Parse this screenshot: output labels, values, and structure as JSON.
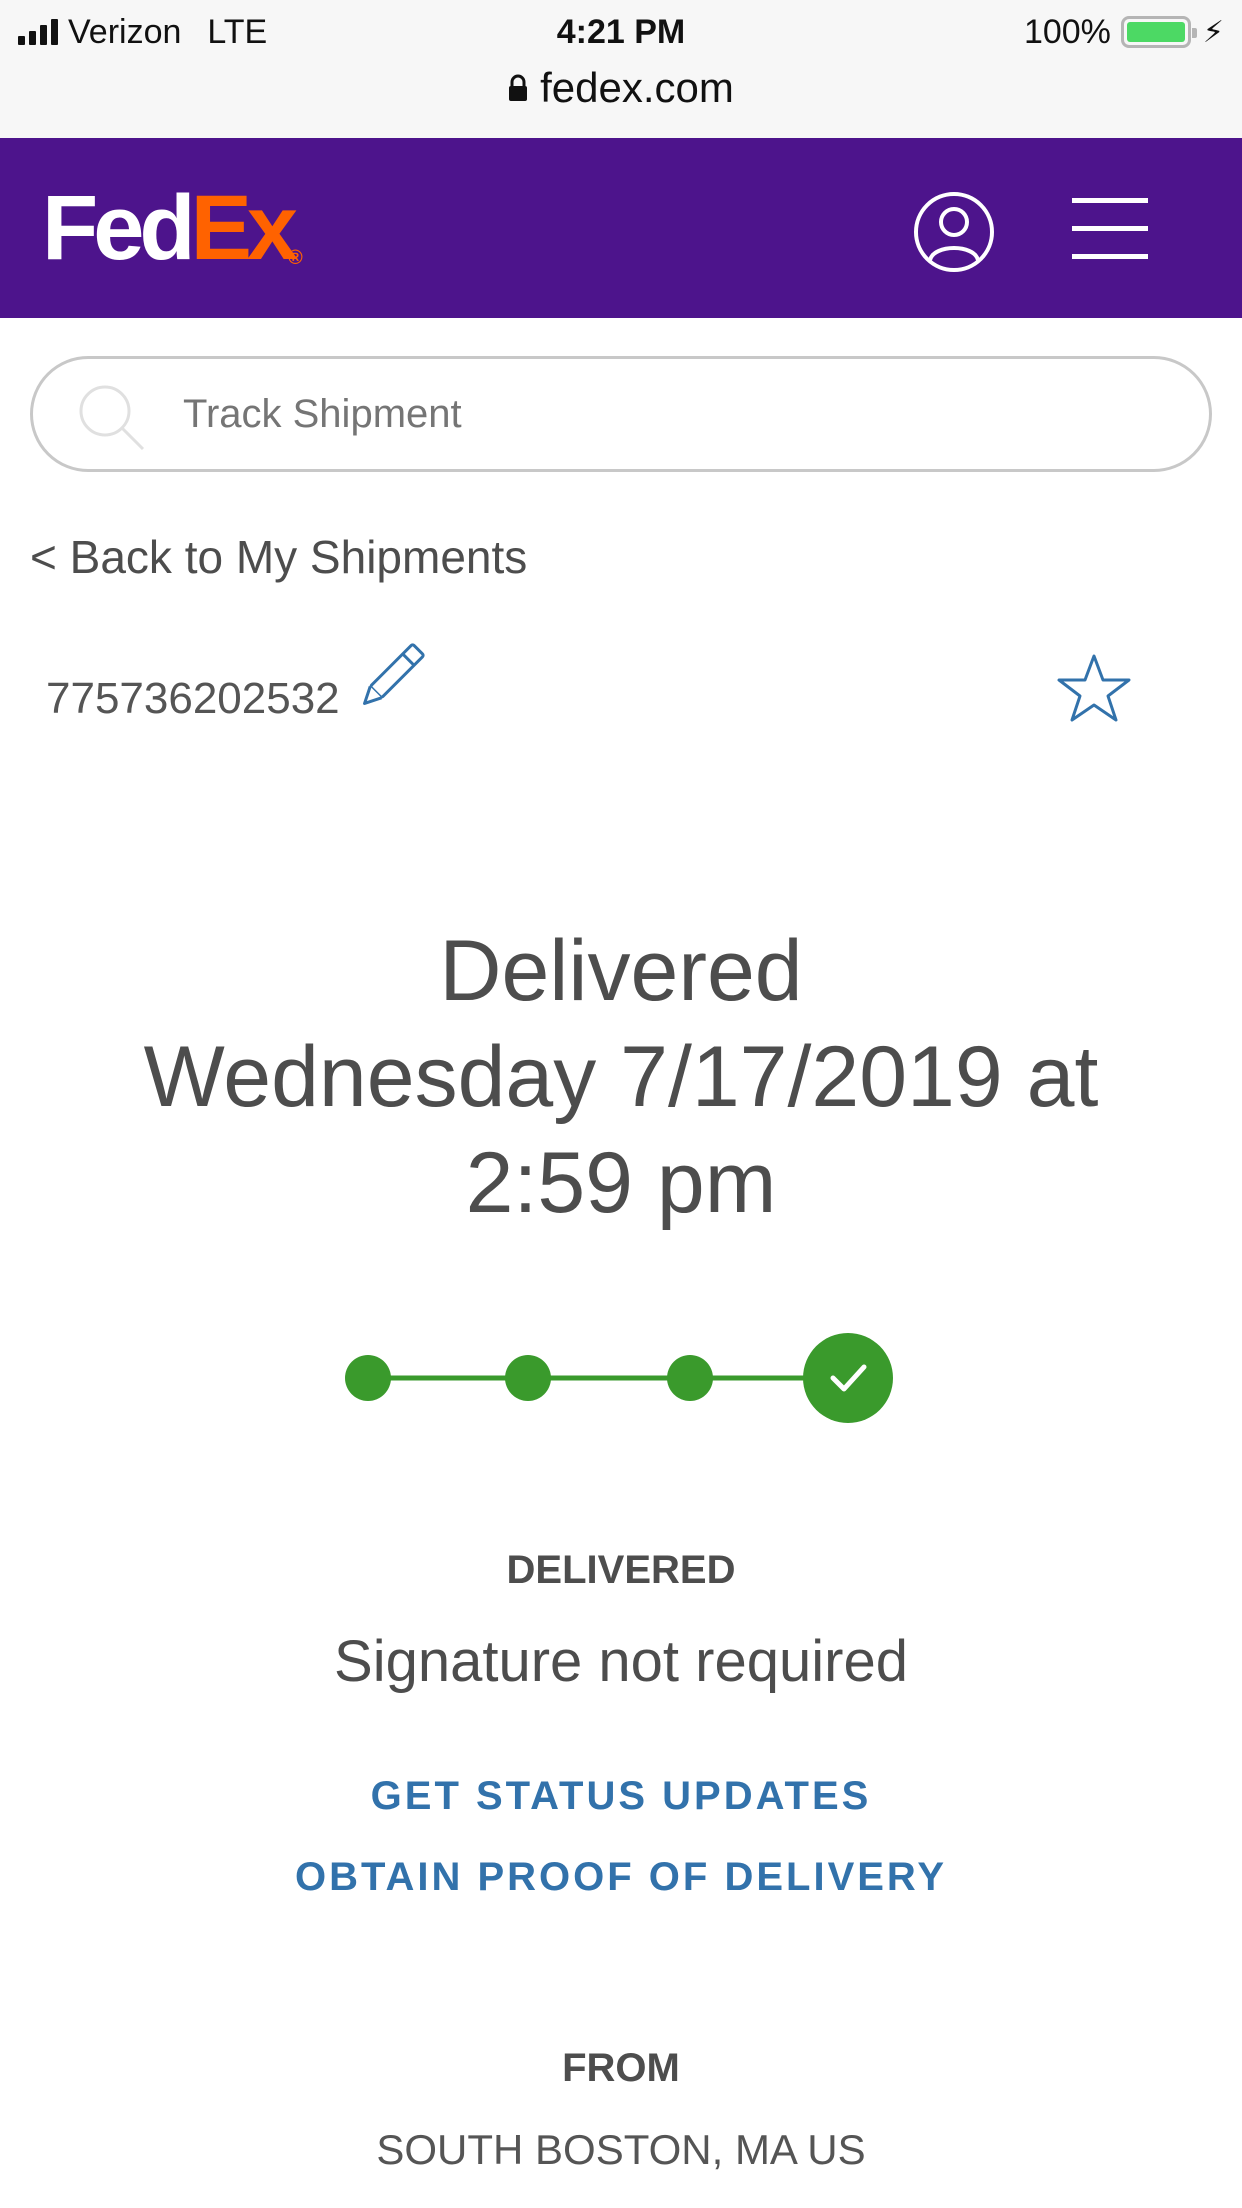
{
  "status_bar": {
    "carrier": "Verizon",
    "network": "LTE",
    "time": "4:21 PM",
    "battery_percent": "100%",
    "battery_level": 1.0,
    "url": "fedex.com"
  },
  "header": {
    "logo_fed": "Fed",
    "logo_ex": "Ex",
    "logo_reg": "®",
    "brand_color": "#4d148c",
    "accent_color": "#ff6200"
  },
  "search": {
    "placeholder": "Track Shipment"
  },
  "nav": {
    "back_label": "< Back to My Shipments"
  },
  "shipment": {
    "tracking_number": "775736202532",
    "headline_lines": [
      "Delivered",
      "Wednesday 7/17/2019 at",
      "2:59 pm"
    ],
    "progress": {
      "steps": 4,
      "completed": 4,
      "color": "#3a9a2c"
    },
    "status": "DELIVERED",
    "signature": "Signature not required",
    "links": {
      "status_updates": "GET STATUS UPDATES",
      "proof_of_delivery": "OBTAIN PROOF OF DELIVERY"
    },
    "from_label": "FROM",
    "from_value": "SOUTH BOSTON, MA US"
  },
  "icons": {
    "lock": "lock-icon",
    "user": "user-account-icon",
    "menu": "hamburger-menu-icon",
    "search": "search-icon",
    "edit": "pencil-icon",
    "favorite": "star-icon",
    "check": "checkmark-icon"
  }
}
